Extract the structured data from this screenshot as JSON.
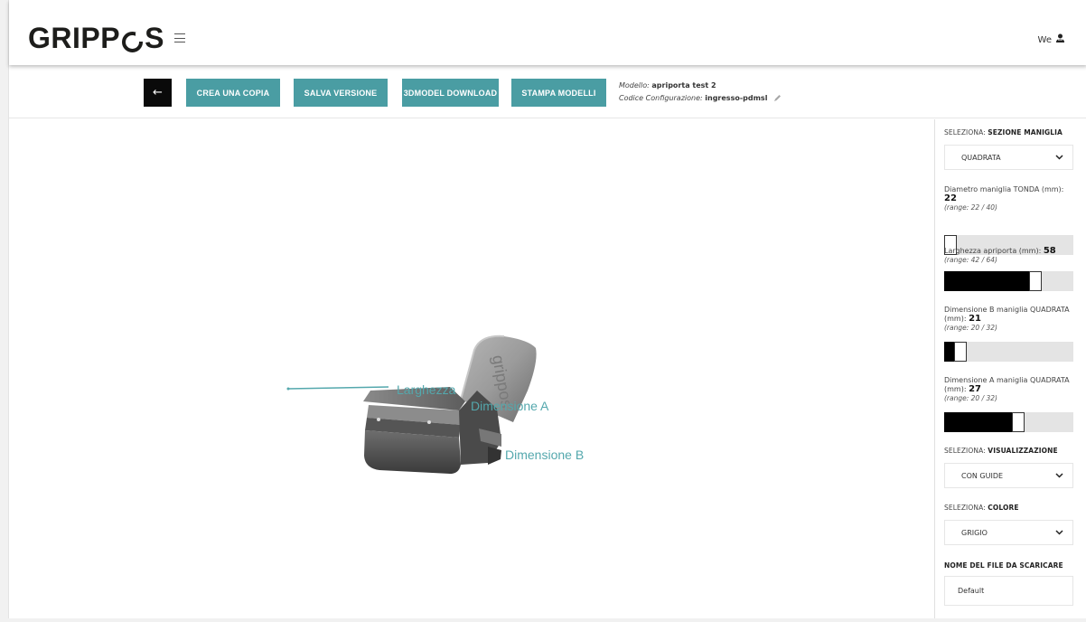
{
  "header": {
    "logo": "GRIPPOS",
    "user_label": "We"
  },
  "toolbar": {
    "back_label": "←",
    "buttons": [
      "CREA UNA COPIA",
      "SALVA VERSIONE",
      "3DMODEL DOWNLOAD",
      "STAMPA MODELLI"
    ],
    "model_label": "Modello:",
    "model_value": "apriporta test 2",
    "config_label": "Codice Configurazione:",
    "config_value": "ingresso-pdmsl"
  },
  "viewer": {
    "labels": [
      "Larghezza",
      "Dimensione A",
      "Dimensione B"
    ],
    "engraving": "grippos"
  },
  "panel": {
    "section_select": {
      "prefix": "SELEZIONA:",
      "title": "SEZIONE MANIGLIA",
      "value": "QUADRATA"
    },
    "params": [
      {
        "label": "Diametro maniglia TONDA (mm):",
        "value": "22",
        "range": "(range: 22 / 40)",
        "min": 22,
        "max": 40,
        "current": 22
      },
      {
        "label": "Larghezza apriporta (mm):",
        "value": "58",
        "range": "(range: 42 / 64)",
        "min": 42,
        "max": 64,
        "current": 58
      },
      {
        "label": "Dimensione B maniglia QUADRATA (mm):",
        "value": "21",
        "range": "(range: 20 / 32)",
        "min": 20,
        "max": 32,
        "current": 21
      },
      {
        "label": "Dimensione A maniglia QUADRATA (mm):",
        "value": "27",
        "range": "(range: 20 / 32)",
        "min": 20,
        "max": 32,
        "current": 27
      }
    ],
    "view_select": {
      "prefix": "SELEZIONA:",
      "title": "VISUALIZZAZIONE",
      "value": "CON GUIDE"
    },
    "color_select": {
      "prefix": "SELEZIONA:",
      "title": "COLORE",
      "value": "GRIGIO"
    },
    "filename": {
      "title": "NOME DEL FILE DA SCARICARE",
      "value": "Default"
    }
  },
  "colors": {
    "accent": "#4a9da3",
    "dark": "#0a0a0a",
    "guide": "#54a8ad"
  },
  "icons": [
    "hamburger-icon",
    "user-icon",
    "back-arrow-icon",
    "pencil-icon",
    "chevron-down-icon"
  ]
}
